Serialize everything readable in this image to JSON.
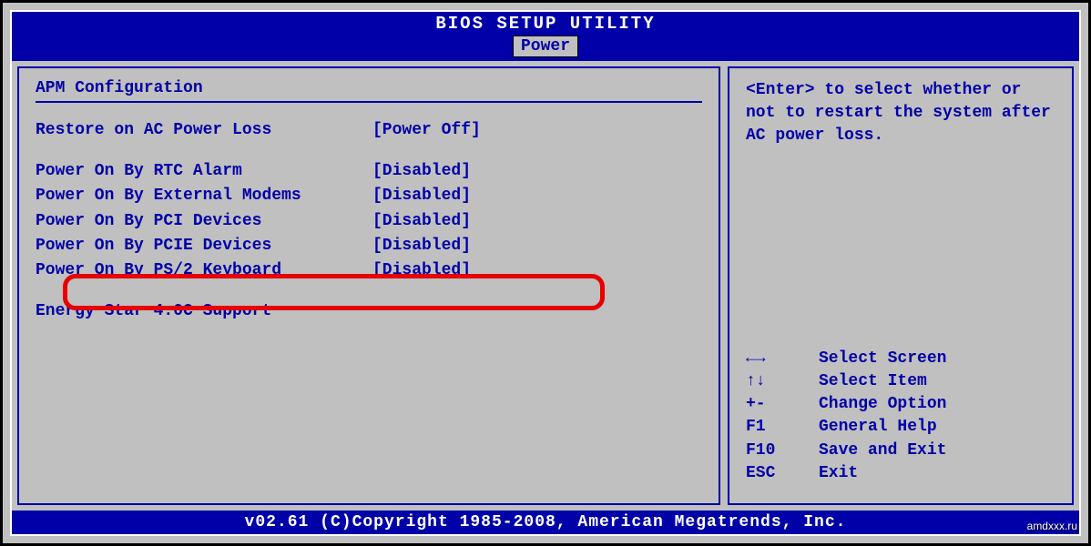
{
  "header": {
    "title": "BIOS SETUP UTILITY",
    "active_tab": "Power"
  },
  "left_panel": {
    "section_title": "APM Configuration",
    "items": [
      {
        "label": "Restore on AC Power Loss",
        "value": "[Power Off]"
      }
    ],
    "items2": [
      {
        "label": "Power On By RTC Alarm",
        "value": "[Disabled]"
      },
      {
        "label": "Power On By External Modems",
        "value": "[Disabled]"
      },
      {
        "label": "Power On By PCI Devices",
        "value": "[Disabled]"
      },
      {
        "label": "Power On By PCIE Devices",
        "value": "[Disabled]"
      },
      {
        "label": "Power On By PS/2 Keyboard",
        "value": "[Disabled]"
      }
    ],
    "items3": [
      {
        "label": "Energy Star 4.0C Support",
        "value": ""
      }
    ]
  },
  "right_panel": {
    "help_text": "<Enter> to select whether or not to restart the system after AC power loss.",
    "keys": [
      {
        "key": "←→",
        "action": "Select Screen"
      },
      {
        "key": "↑↓",
        "action": "Select Item"
      },
      {
        "key": "+-",
        "action": "Change Option"
      },
      {
        "key": "F1",
        "action": "General Help"
      },
      {
        "key": "F10",
        "action": "Save and Exit"
      },
      {
        "key": "ESC",
        "action": "Exit"
      }
    ]
  },
  "footer": {
    "copyright": "v02.61 (C)Copyright 1985-2008, American Megatrends, Inc."
  },
  "watermark": "amdxxx.ru"
}
